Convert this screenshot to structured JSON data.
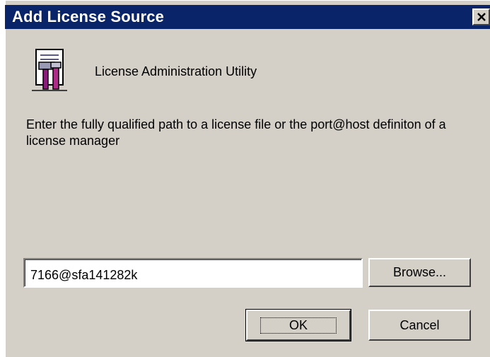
{
  "dialog": {
    "title": "Add License Source",
    "close_symbol": "✕",
    "app_icon": "license-utility-icon",
    "app_name": "License Administration Utility",
    "instructions": "Enter the fully qualified path to a license file or the port@host definiton of a license manager",
    "path_input": {
      "value": "7166@sfa141282k"
    },
    "buttons": {
      "browse": "Browse...",
      "ok": "OK",
      "cancel": "Cancel"
    },
    "colors": {
      "title_bar": "#0a246a",
      "face": "#d4d0c8"
    }
  }
}
